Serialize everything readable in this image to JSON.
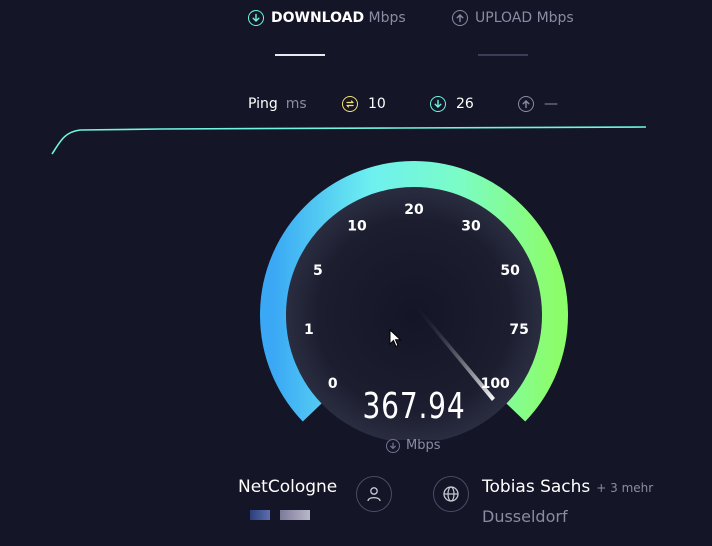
{
  "tabs": {
    "download": {
      "label": "DOWNLOAD",
      "unit": "Mbps"
    },
    "upload": {
      "label": "UPLOAD",
      "unit": "Mbps"
    }
  },
  "ping": {
    "label": "Ping",
    "unit": "ms",
    "idle_value": "10",
    "download_value": "26",
    "upload_value": "—"
  },
  "gauge": {
    "value": "367.94",
    "unit": "Mbps",
    "ticks": [
      "0",
      "1",
      "5",
      "10",
      "20",
      "30",
      "50",
      "75",
      "100"
    ],
    "needle_level": 1.0
  },
  "provider": {
    "name": "NetCologne"
  },
  "server": {
    "host": "Tobias Sachs",
    "more": "+ 3 mehr",
    "location": "Dusseldorf"
  },
  "colors": {
    "background": "#141526",
    "accent_cyan": "#6ff5e1",
    "ping_idle": "#f4e26c",
    "gauge_blue": "#3aa8f5",
    "gauge_green": "#8cfd6a"
  }
}
